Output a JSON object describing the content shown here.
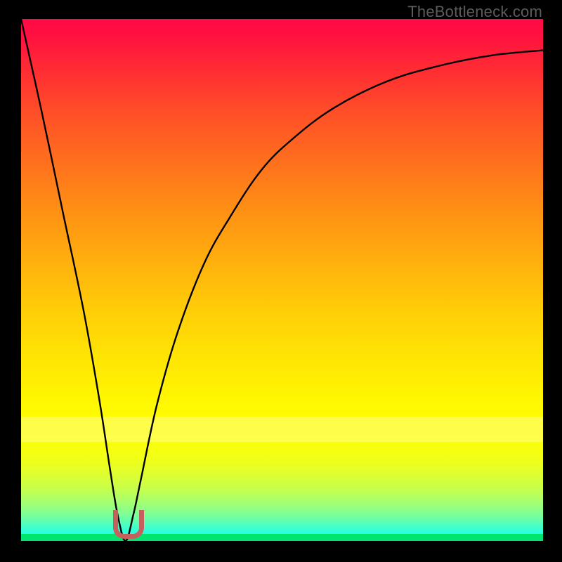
{
  "watermark": "TheBottleneck.com",
  "colors": {
    "frame": "#000000",
    "curve": "#000000",
    "marker": "#c7605d",
    "gradient_top": "#ff0a46",
    "gradient_bottom": "#00ffff",
    "green_band": "#00e56e"
  },
  "chart_data": {
    "type": "line",
    "title": "",
    "xlabel": "",
    "ylabel": "",
    "xlim": [
      0,
      100
    ],
    "ylim": [
      0,
      100
    ],
    "grid": false,
    "legend": false,
    "annotations": [
      "TheBottleneck.com"
    ],
    "series": [
      {
        "name": "bottleneck-curve",
        "x": [
          0,
          4,
          8,
          12,
          15,
          17,
          18.5,
          20,
          21.5,
          23,
          26,
          30,
          35,
          40,
          46,
          52,
          60,
          70,
          80,
          90,
          100
        ],
        "values": [
          100,
          82,
          63,
          44,
          27,
          14,
          5,
          0,
          5,
          12,
          26,
          40,
          53,
          62,
          71,
          77,
          83,
          88,
          91,
          93,
          94
        ]
      }
    ],
    "min_point": {
      "x": 20,
      "y": 0
    },
    "white_band_y_range": [
      20,
      25
    ]
  }
}
